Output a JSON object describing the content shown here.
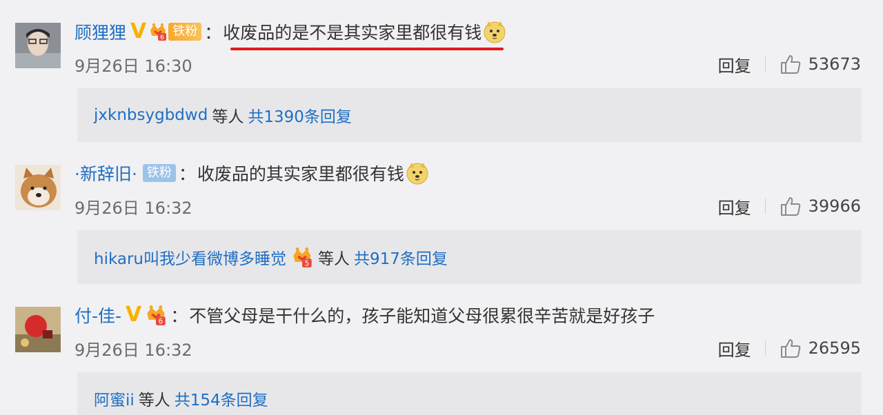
{
  "comments": [
    {
      "username": "顾狸狸",
      "verified": "V",
      "fan_badge": "铁粉",
      "fan_level": "6",
      "colon": "：",
      "text": "收废品的是不是其实家里都很有钱",
      "has_emoji": true,
      "highlighted": true,
      "date": "9月26日 16:30",
      "reply_label": "回复",
      "likes": "53673",
      "replies": {
        "names": "jxknbsygbdwd",
        "middle": "等人",
        "count": "共1390条回复"
      }
    },
    {
      "username": "·新辞旧·",
      "fan_badge": "铁粉",
      "colon": "：",
      "text": "收废品的其实家里都很有钱",
      "has_emoji": true,
      "date": "9月26日 16:32",
      "reply_label": "回复",
      "likes": "39966",
      "replies": {
        "names": "hikaru叫我少看微博多睡觉",
        "level": "5",
        "middle": "等人",
        "count": "共917条回复"
      }
    },
    {
      "username": "付-佳-",
      "verified": "V",
      "fan_level": "6",
      "colon": "：",
      "text": "不管父母是干什么的，孩子能知道父母很累很辛苦就是好孩子",
      "date": "9月26日 16:32",
      "reply_label": "回复",
      "likes": "26595",
      "replies": {
        "names": "阿蜜ii",
        "middle": "等人",
        "count": "共154条回复"
      }
    }
  ],
  "colors": {
    "link": "#1f6ec2",
    "verified": "#f8b200",
    "highlight_underline": "#e21b1b",
    "background": "#f1f1f3",
    "reply_box": "#e7e7ea"
  },
  "icons": [
    "verified-v-icon",
    "crown-level-icon",
    "doge-emoji-icon",
    "thumbs-up-icon"
  ]
}
